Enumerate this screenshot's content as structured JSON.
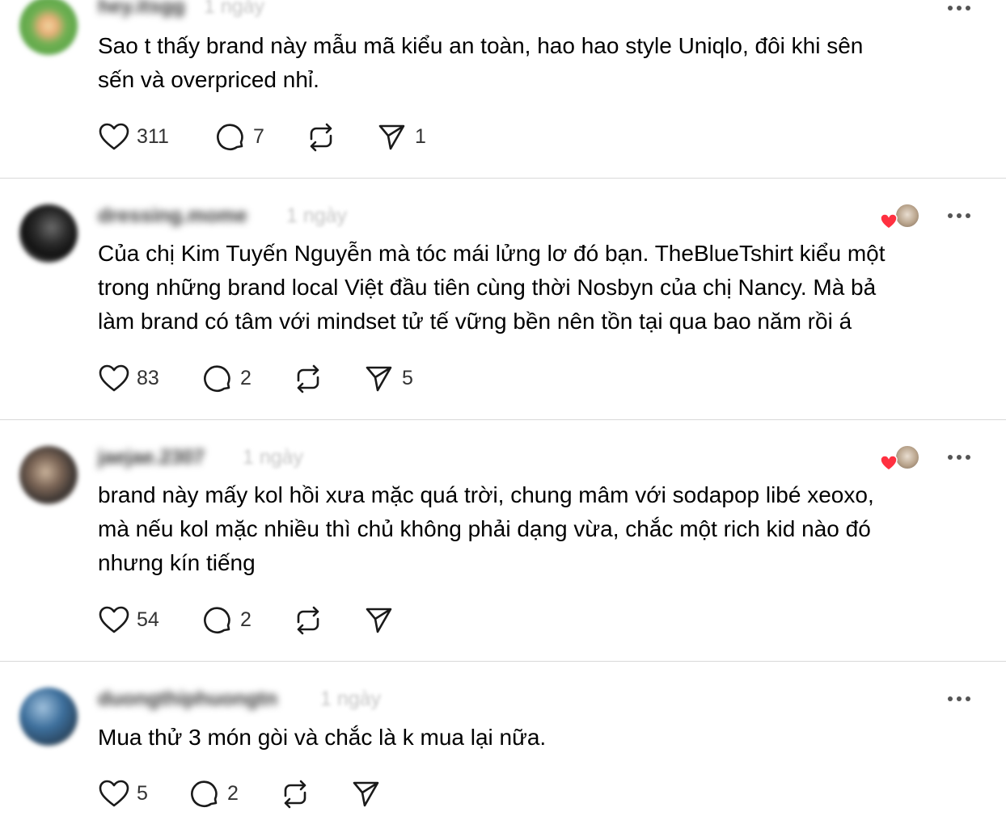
{
  "posts": [
    {
      "username": "hey.itsgg",
      "time": "1 ngày",
      "text_lines": [
        "Sao t thấy brand này mẫu mã kiểu an toàn, hao hao style Uniqlo, đôi khi sên",
        "sến và overpriced nhỉ."
      ],
      "likes": "311",
      "replies": "7",
      "reposts": "",
      "shares": "1",
      "avatar_colors": [
        "#5fa84a",
        "#e9b07a"
      ],
      "liked_by_author": false
    },
    {
      "username": "dressing.mome",
      "time": "1 ngày",
      "text_lines": [
        "Của chị Kim Tuyến Nguyễn mà tóc mái lửng lơ đó bạn. TheBlueTshirt kiểu một",
        "trong những brand local Việt đầu tiên cùng thời Nosbyn của chị Nancy. Mà bả",
        "làm brand có tâm với mindset tử tế vững bền nên tồn tại qua bao năm rồi á"
      ],
      "likes": "83",
      "replies": "2",
      "reposts": "",
      "shares": "5",
      "avatar_colors": [
        "#1a1a1a",
        "#9a9a9a"
      ],
      "liked_by_author": true
    },
    {
      "username": "jaejae.2307",
      "time": "1 ngày",
      "text_lines": [
        "brand này mấy kol hồi xưa mặc quá trời, chung mâm với sodapop libé xeoxo,",
        "mà nếu kol mặc nhiều thì chủ không phải dạng vừa, chắc một rich kid nào đó",
        "nhưng kín tiếng"
      ],
      "likes": "54",
      "replies": "2",
      "reposts": "",
      "shares": "",
      "avatar_colors": [
        "#3b3532",
        "#b7a08c"
      ],
      "liked_by_author": true
    },
    {
      "username": "duongthiphuongtn",
      "time": "1 ngày",
      "text_lines": [
        "Mua thử 3 món gòi và chắc là k mua lại nữa."
      ],
      "likes": "5",
      "replies": "2",
      "reposts": "",
      "shares": "",
      "avatar_colors": [
        "#3d6f9c",
        "#8a7a66"
      ],
      "liked_by_author": false
    }
  ],
  "colors": {
    "heart_red": "#ff3040",
    "divider": "#d9d9d9",
    "icon": "#1a1a1a",
    "meta_gray": "#c4c4c4"
  },
  "icons": {
    "like": "heart-icon",
    "reply": "comment-icon",
    "repost": "repost-icon",
    "share": "share-icon",
    "more": "more-icon"
  }
}
